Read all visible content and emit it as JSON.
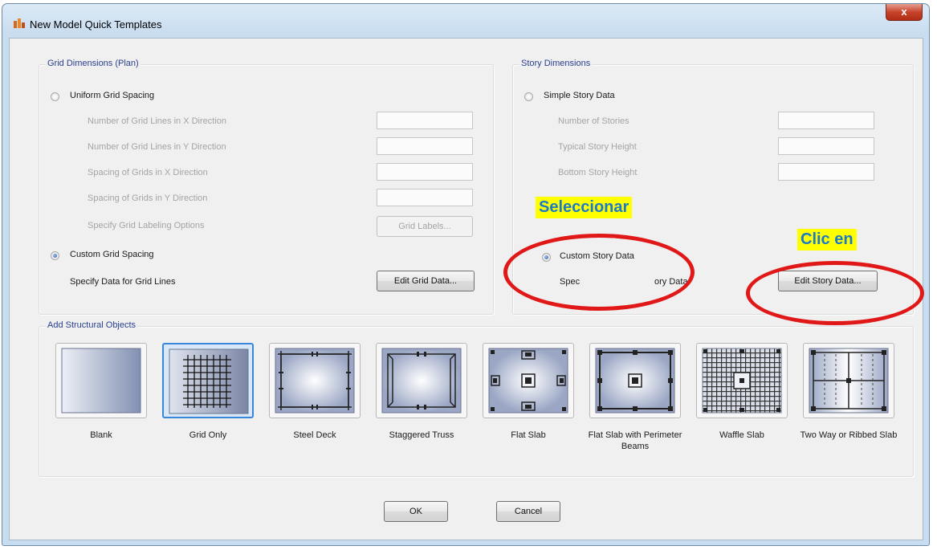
{
  "window": {
    "title": "New Model Quick Templates",
    "close_glyph": "x"
  },
  "grid": {
    "legend": "Grid Dimensions (Plan)",
    "uniform_label": "Uniform Grid Spacing",
    "fields": [
      "Number of Grid Lines in X Direction",
      "Number of Grid Lines in Y Direction",
      "Spacing of Grids in X Direction",
      "Spacing of Grids in Y Direction"
    ],
    "labeling_label": "Specify Grid Labeling Options",
    "labels_button": "Grid Labels...",
    "custom_label": "Custom Grid Spacing",
    "specify_label": "Specify Data for Grid Lines",
    "edit_button": "Edit Grid Data..."
  },
  "story": {
    "legend": "Story Dimensions",
    "simple_label": "Simple Story Data",
    "fields": [
      "Number of Stories",
      "Typical Story Height",
      "Bottom Story Height"
    ],
    "custom_label": "Custom Story Data",
    "specify_label_a": "Spec",
    "specify_label_b": "ory Data",
    "edit_button": "Edit Story Data..."
  },
  "structural": {
    "legend": "Add Structural Objects",
    "templates": [
      {
        "name": "Blank",
        "icon": "blank-template-icon"
      },
      {
        "name": "Grid Only",
        "icon": "grid-only-template-icon",
        "selected": true
      },
      {
        "name": "Steel Deck",
        "icon": "steel-deck-template-icon"
      },
      {
        "name": "Staggered Truss",
        "icon": "staggered-truss-template-icon"
      },
      {
        "name": "Flat Slab",
        "icon": "flat-slab-template-icon"
      },
      {
        "name": "Flat Slab with Perimeter Beams",
        "icon": "flat-slab-perimeter-beams-template-icon"
      },
      {
        "name": "Waffle Slab",
        "icon": "waffle-slab-template-icon"
      },
      {
        "name": "Two Way or Ribbed Slab",
        "icon": "two-way-ribbed-slab-template-icon"
      }
    ]
  },
  "buttons": {
    "ok": "OK",
    "cancel": "Cancel"
  },
  "annotations": {
    "select_callout": "Seleccionar",
    "click_callout": "Clic en",
    "highlight_color": "#ffff00",
    "ring_color": "#e01818"
  },
  "state": {
    "grid_mode": "custom",
    "story_mode": "custom"
  }
}
